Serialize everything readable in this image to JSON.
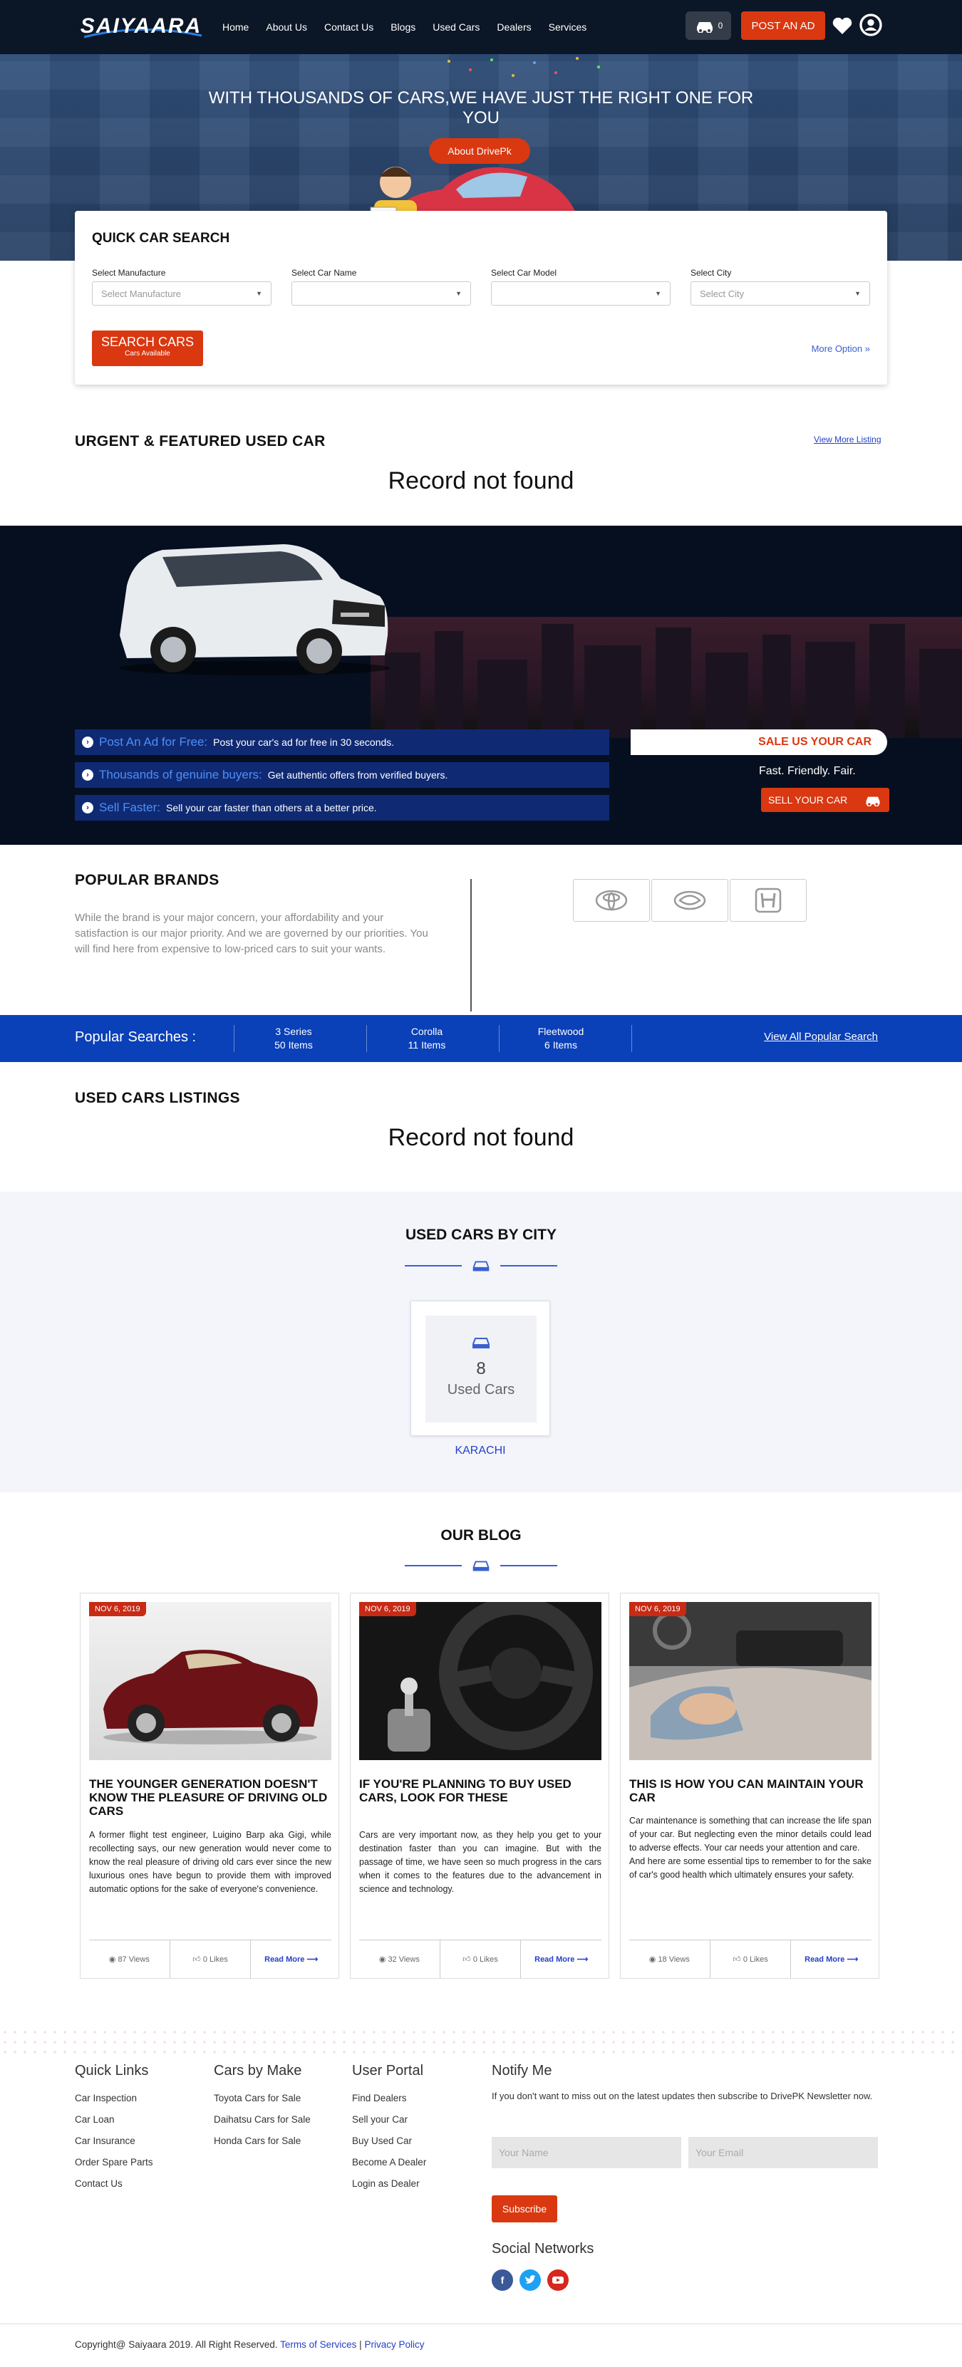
{
  "header": {
    "logo_text": "SAIYAARA",
    "nav": [
      "Home",
      "About Us",
      "Contact Us",
      "Blogs",
      "Used Cars",
      "Dealers",
      "Services"
    ],
    "cart_count": "0",
    "post_ad": "POST AN AD"
  },
  "hero": {
    "title": "WITH THOUSANDS OF CARS,WE HAVE JUST THE RIGHT ONE FOR YOU",
    "about_button": "About DrivePk"
  },
  "quick_search": {
    "title": "QUICK CAR SEARCH",
    "fields": [
      {
        "label": "Select Manufacture",
        "value": "Select Manufacture"
      },
      {
        "label": "Select Car Name",
        "value": ""
      },
      {
        "label": "Select Car Model",
        "value": ""
      },
      {
        "label": "Select City",
        "value": "Select City"
      }
    ],
    "search_button": "SEARCH CARS",
    "search_sub": "Cars Available",
    "more_option": "More Option"
  },
  "urgent": {
    "title": "URGENT & FEATURED USED CAR",
    "view_more": "View More Listing",
    "empty": "Record not found"
  },
  "sell_banner": {
    "features": [
      {
        "highlight": "Post An Ad for Free:",
        "text": "Post your car's ad for free in 30 seconds."
      },
      {
        "highlight": "Thousands of genuine buyers:",
        "text": "Get authentic offers from verified buyers."
      },
      {
        "highlight": "Sell Faster:",
        "text": "Sell your car faster than others at a better price."
      }
    ],
    "sale_title": "SALE US YOUR CAR",
    "tagline": "Fast. Friendly. Fair.",
    "sell_button": "SELL YOUR CAR"
  },
  "brands": {
    "title": "POPULAR BRANDS",
    "text": "While the brand is your major concern, your affordability and your satisfaction is our major priority. And we are governed by our priorities. You will find here from expensive to low-priced cars to suit your wants.",
    "logos": [
      "toyota-logo",
      "daihatsu-logo",
      "honda-logo"
    ]
  },
  "popular_searches": {
    "title": "Popular Searches :",
    "items": [
      {
        "name": "3 Series",
        "count": "50 Items"
      },
      {
        "name": "Corolla",
        "count": "11 Items"
      },
      {
        "name": "Fleetwood",
        "count": "6 Items"
      }
    ],
    "view_all": "View All Popular Search"
  },
  "listings": {
    "title": "USED CARS LISTINGS",
    "empty": "Record not found"
  },
  "by_city": {
    "title": "USED CARS BY CITY",
    "cards": [
      {
        "count": "8",
        "label": "Used Cars",
        "city": "KARACHI"
      }
    ]
  },
  "blog": {
    "title": "OUR BLOG",
    "posts": [
      {
        "date": "NOV 6, 2019",
        "title": "THE YOUNGER GENERATION DOESN'T KNOW THE PLEASURE OF DRIVING OLD CARS",
        "text": "A former flight test engineer, Luigino Barp aka Gigi, while recollecting says, our new generation would never come to know the real pleasure of driving old cars ever since the new luxurious ones have begun to provide them with improved automatic options for the sake of everyone's convenience.",
        "views": "87 Views",
        "likes": "0 Likes",
        "read_more": "Read More"
      },
      {
        "date": "NOV 6, 2019",
        "title": "IF YOU'RE PLANNING TO BUY USED CARS, LOOK FOR THESE",
        "text": "Cars are very important now, as they help you get to your destination faster than you can imagine. But with the passage of time, we have seen so much progress in the cars when it comes to the features due to the advancement in science and technology.",
        "views": "32 Views",
        "likes": "0 Likes",
        "read_more": "Read More"
      },
      {
        "date": "NOV 6, 2019",
        "title": "THIS IS HOW YOU CAN MAINTAIN YOUR CAR",
        "text": "Car maintenance is something that can increase the life span of your car. But neglecting even the minor details could lead to adverse effects. Your car needs your attention and care.\nAnd here are some essential tips to remember to for the sake of car's good health which ultimately ensures your safety.",
        "views": "18 Views",
        "likes": "0 Likes",
        "read_more": "Read More"
      }
    ]
  },
  "footer": {
    "quick_links": {
      "title": "Quick Links",
      "items": [
        "Car Inspection",
        "Car Loan",
        "Car Insurance",
        "Order Spare Parts",
        "Contact Us"
      ]
    },
    "cars_by_make": {
      "title": "Cars by Make",
      "items": [
        "Toyota Cars for Sale",
        "Daihatsu Cars for Sale",
        "Honda Cars for Sale"
      ]
    },
    "user_portal": {
      "title": "User Portal",
      "items": [
        "Find Dealers",
        "Sell your Car",
        "Buy Used Car",
        "Become A Dealer",
        "Login as Dealer"
      ]
    },
    "notify": {
      "title": "Notify Me",
      "text": "If you don't want to miss out on the latest updates then subscribe to DrivePK Newsletter now.",
      "name_placeholder": "Your Name",
      "email_placeholder": "Your Email",
      "subscribe": "Subscribe"
    },
    "social_title": "Social Networks",
    "copyright": "Copyright@ Saiyaara 2019. All Right Reserved.",
    "terms": "Terms of Services",
    "separator": "|",
    "privacy": "Privacy Policy"
  },
  "colors": {
    "accent": "#d93811",
    "header_bg": "#0b1626",
    "link_blue": "#2540c8",
    "popular_bar": "#0a40b8"
  }
}
